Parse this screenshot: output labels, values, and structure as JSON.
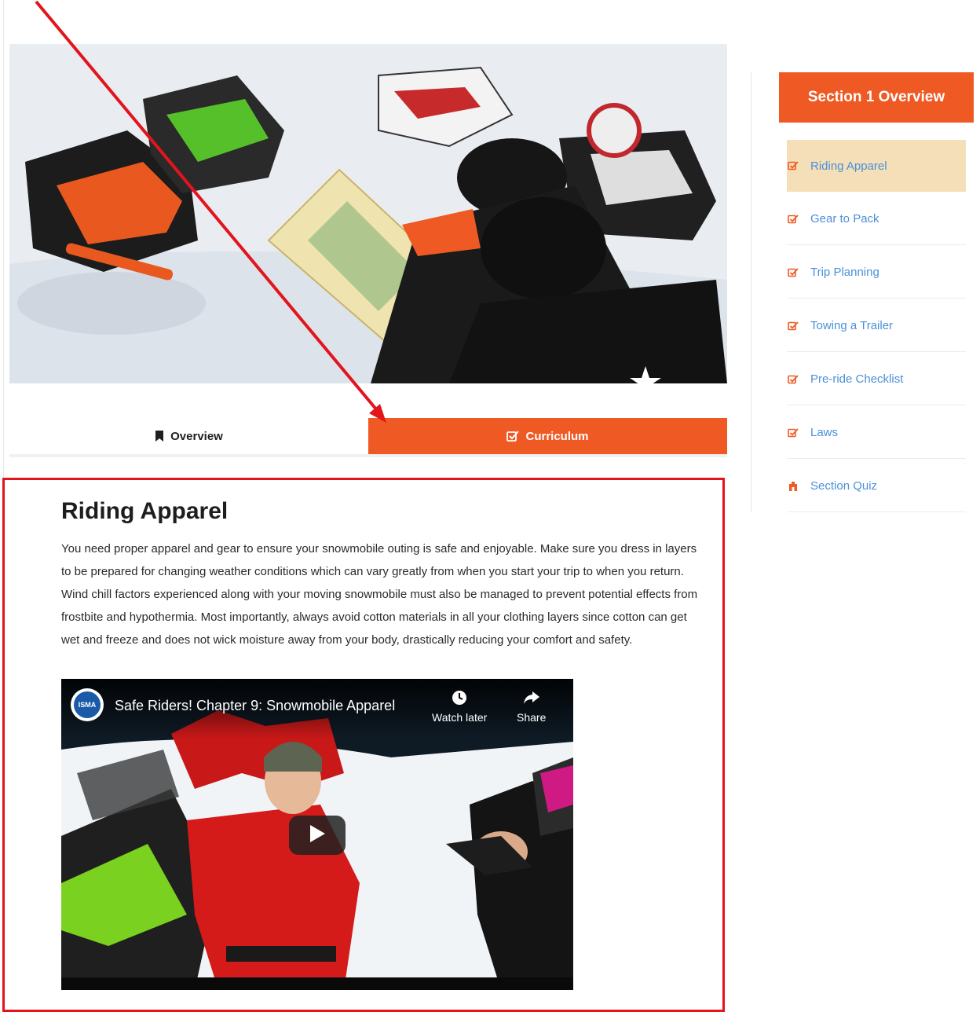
{
  "tabs": {
    "overview_label": "Overview",
    "curriculum_label": "Curriculum",
    "active": "Curriculum"
  },
  "lesson": {
    "title": "Riding Apparel",
    "body": "You need proper apparel and gear to ensure your snowmobile outing is safe and enjoyable. Make sure you dress in layers to be prepared for changing weather conditions which can vary greatly from when you start your trip to when you return. Wind chill factors experienced along with your moving snowmobile must also be managed to prevent potential effects from frostbite and hypothermia. Most importantly, always avoid cotton materials in all your clothing layers since cotton can get wet and freeze and does not wick moisture away from your body, drastically reducing your comfort and safety."
  },
  "video": {
    "title": "Safe Riders! Chapter 9: Snowmobile Apparel",
    "channel_logo_text": "ISMA",
    "watch_later_label": "Watch later",
    "share_label": "Share"
  },
  "sidebar": {
    "header": "Section 1 Overview",
    "items": [
      {
        "label": "Riding Apparel",
        "icon": "checkbox-icon",
        "active": true
      },
      {
        "label": "Gear to Pack",
        "icon": "checkbox-icon",
        "active": false
      },
      {
        "label": "Trip Planning",
        "icon": "checkbox-icon",
        "active": false
      },
      {
        "label": "Towing a Trailer",
        "icon": "checkbox-icon",
        "active": false
      },
      {
        "label": "Pre-ride Checklist",
        "icon": "checkbox-icon",
        "active": false
      },
      {
        "label": "Laws",
        "icon": "checkbox-icon",
        "active": false
      },
      {
        "label": "Section Quiz",
        "icon": "quiz-icon",
        "active": false
      }
    ]
  },
  "colors": {
    "accent": "#ef5a24",
    "link": "#4a90d9",
    "active_item_bg": "#f4dfb8",
    "annotation": "#e3141c"
  }
}
